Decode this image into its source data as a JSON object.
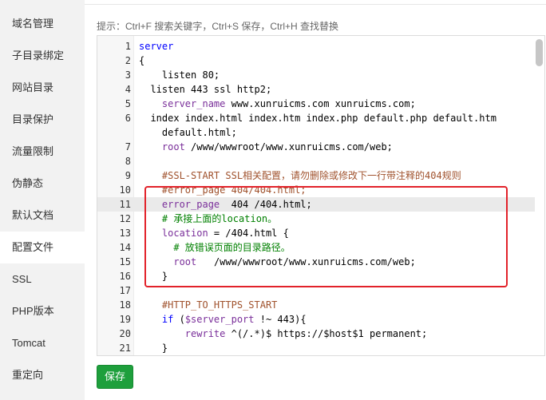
{
  "sidebar": {
    "items": [
      {
        "label": "域名管理",
        "active": false
      },
      {
        "label": "子目录绑定",
        "active": false
      },
      {
        "label": "网站目录",
        "active": false
      },
      {
        "label": "目录保护",
        "active": false
      },
      {
        "label": "流量限制",
        "active": false
      },
      {
        "label": "伪静态",
        "active": false
      },
      {
        "label": "默认文档",
        "active": false
      },
      {
        "label": "配置文件",
        "active": true
      },
      {
        "label": "SSL",
        "active": false
      },
      {
        "label": "PHP版本",
        "active": false
      },
      {
        "label": "Tomcat",
        "active": false
      },
      {
        "label": "重定向",
        "active": false
      }
    ]
  },
  "hint": "提示：Ctrl+F 搜索关键字，Ctrl+S 保存，Ctrl+H 查找替换",
  "editor": {
    "active_line": 11,
    "lines": [
      {
        "no": "1",
        "text": "server"
      },
      {
        "no": "2",
        "text": "{"
      },
      {
        "no": "3",
        "text": "    listen 80;"
      },
      {
        "no": "4",
        "text": "  listen 443 ssl http2;"
      },
      {
        "no": "5",
        "text": "    server_name www.xunruicms.com xunruicms.com;"
      },
      {
        "no": "6",
        "text": "  index index.html index.htm index.php default.php default.htm"
      },
      {
        "no": "",
        "text": "    default.html;"
      },
      {
        "no": "7",
        "text": "    root /www/wwwroot/www.xunruicms.com/web;"
      },
      {
        "no": "8",
        "text": ""
      },
      {
        "no": "9",
        "text": "    #SSL-START SSL相关配置，请勿删除或修改下一行带注释的404规则"
      },
      {
        "no": "10",
        "text": "    #error_page 404/404.html;"
      },
      {
        "no": "11",
        "text": "    error_page  404 /404.html;"
      },
      {
        "no": "12",
        "text": "    # 承接上面的location。"
      },
      {
        "no": "13",
        "text": "    location = /404.html {"
      },
      {
        "no": "14",
        "text": "      # 放错误页面的目录路径。"
      },
      {
        "no": "15",
        "text": "      root   /www/wwwroot/www.xunruicms.com/web;"
      },
      {
        "no": "16",
        "text": "    }"
      },
      {
        "no": "17",
        "text": ""
      },
      {
        "no": "18",
        "text": "    #HTTP_TO_HTTPS_START"
      },
      {
        "no": "19",
        "text": "    if ($server_port !~ 443){"
      },
      {
        "no": "20",
        "text": "        rewrite ^(/.*)$ https://$host$1 permanent;"
      },
      {
        "no": "21",
        "text": "    }"
      }
    ]
  },
  "save_button": "保存",
  "colors": {
    "save_button_bg": "#1e9f3c",
    "highlight_border": "#e2222a",
    "sidebar_bg": "#f2f2f2"
  }
}
